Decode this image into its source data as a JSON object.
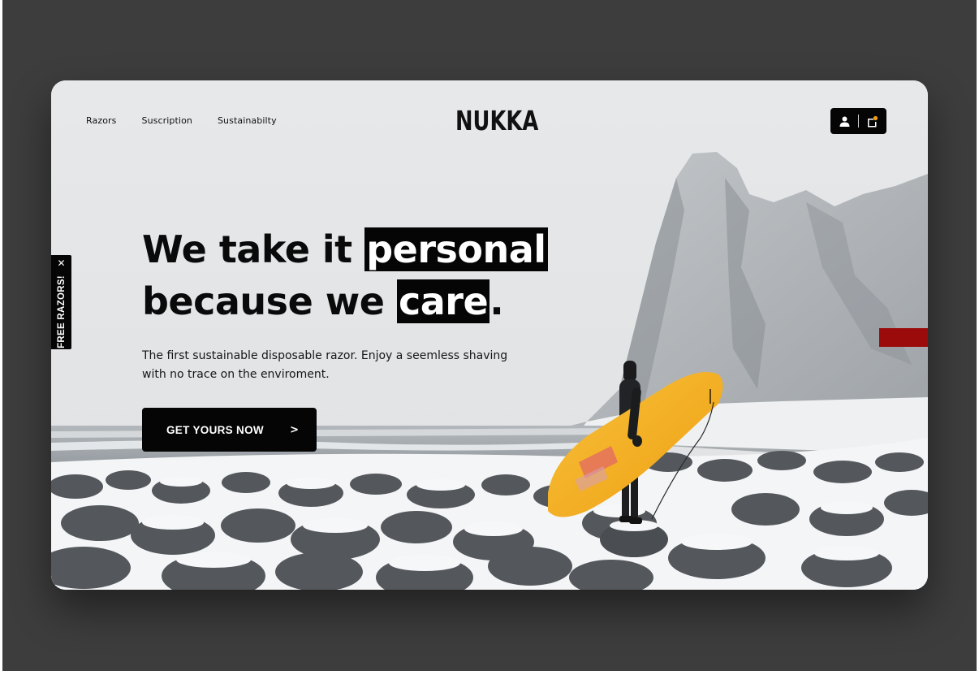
{
  "brand": {
    "logo": "NUKKA"
  },
  "nav": {
    "items": [
      "Razors",
      "Suscription",
      "Sustainabilty"
    ]
  },
  "header": {
    "user_icon": "user-icon",
    "cart_icon": "cart-icon"
  },
  "promo": {
    "label": "FREE RAZORS!",
    "close_glyph": "✕"
  },
  "hero": {
    "line1_text": "We take it ",
    "line1_highlight": "personal",
    "line2_text": "because we ",
    "line2_highlight": "care",
    "line2_end": ".",
    "subtitle": "The first sustainable disposable razor. Enjoy a seemless shaving with no trace on the enviroment.",
    "cta_label": "GET YOURS NOW",
    "cta_arrow": ">"
  },
  "colors": {
    "frame_bg": "#3d3d3d",
    "accent_black": "#050505",
    "accent_red": "#9b0b0b",
    "board_yellow": "#f5ad1c",
    "notification_dot": "#f59e0b"
  }
}
